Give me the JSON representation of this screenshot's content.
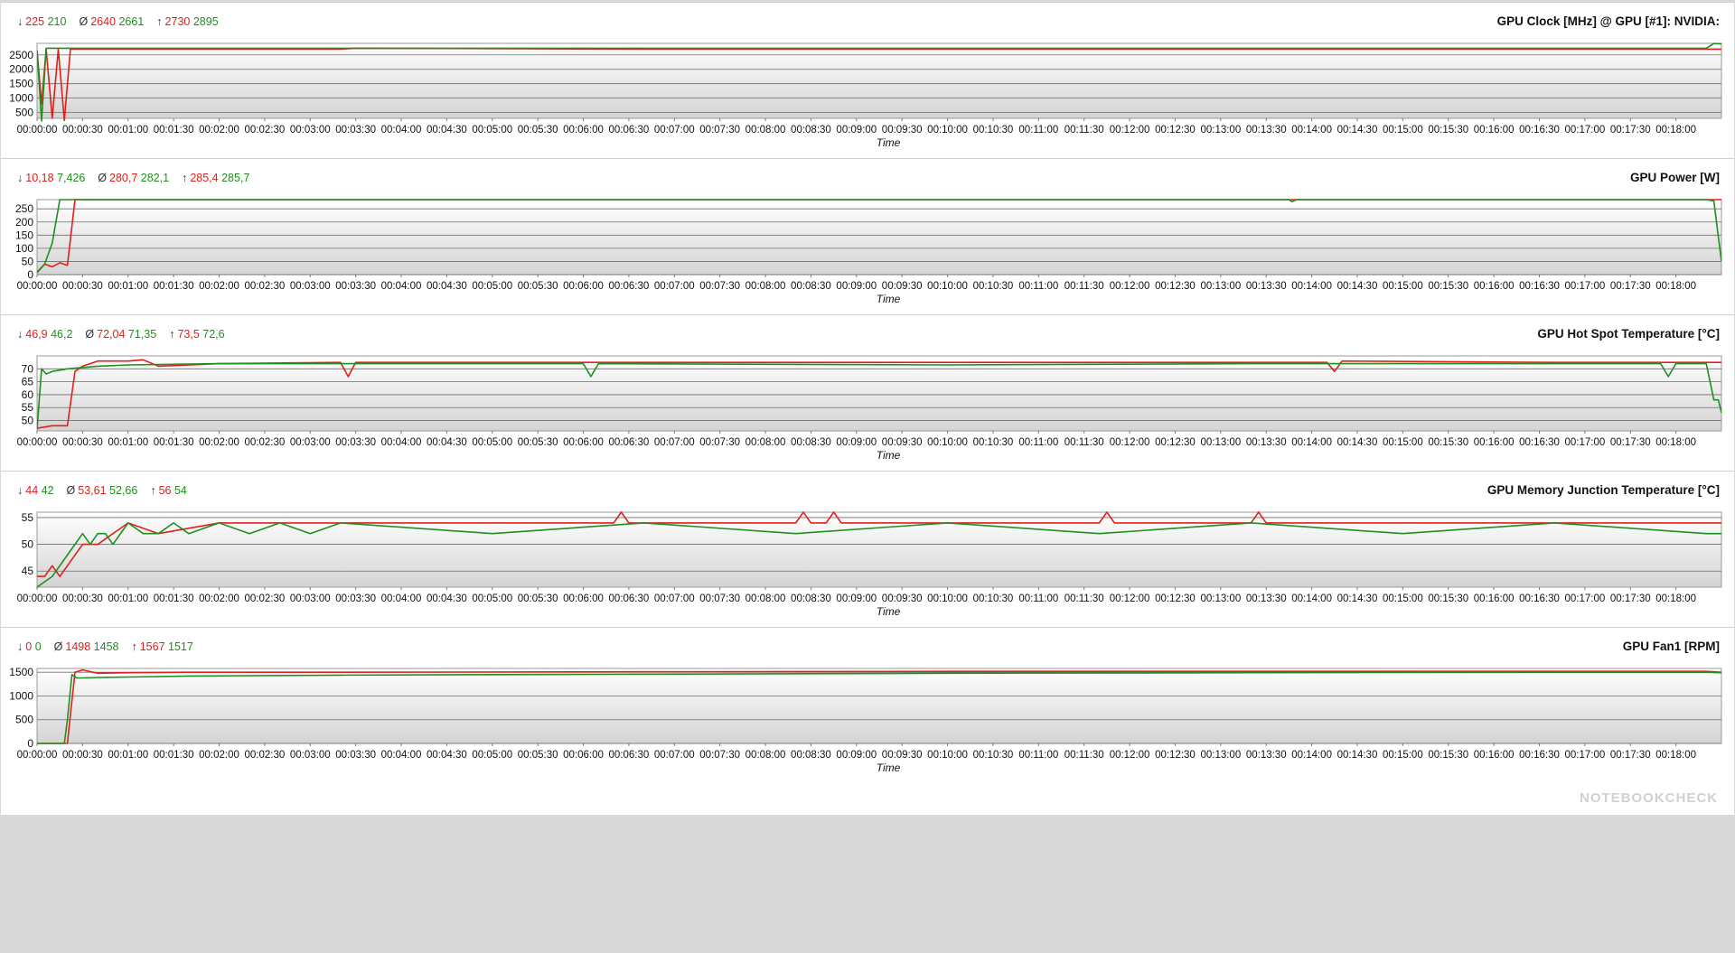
{
  "colors": {
    "run1": "#e0201c",
    "run2": "#1f8f1f"
  },
  "symbols": {
    "min": "↓",
    "avg": "Ø",
    "max": "↑"
  },
  "x_tick_labels": [
    "00:00:00",
    "00:00:30",
    "00:01:00",
    "00:01:30",
    "00:02:00",
    "00:02:30",
    "00:03:00",
    "00:03:30",
    "00:04:00",
    "00:04:30",
    "00:05:00",
    "00:05:30",
    "00:06:00",
    "00:06:30",
    "00:07:00",
    "00:07:30",
    "00:08:00",
    "00:08:30",
    "00:09:00",
    "00:09:30",
    "00:10:00",
    "00:10:30",
    "00:11:00",
    "00:11:30",
    "00:12:00",
    "00:12:30",
    "00:13:00",
    "00:13:30",
    "00:14:00",
    "00:14:30",
    "00:15:00",
    "00:15:30",
    "00:16:00",
    "00:16:30",
    "00:17:00",
    "00:17:30",
    "00:18:00"
  ],
  "watermark": "NOTEBOOKCHECK",
  "panels": [
    {
      "title": "GPU Clock [MHz] @ GPU [#1]: NVIDIA:",
      "stats": {
        "min": [
          "225",
          "210"
        ],
        "avg": [
          "2640",
          "2661"
        ],
        "max": [
          "2730",
          "2895"
        ]
      }
    },
    {
      "title": "GPU Power [W]",
      "stats": {
        "min": [
          "10,18",
          "7,426"
        ],
        "avg": [
          "280,7",
          "282,1"
        ],
        "max": [
          "285,4",
          "285,7"
        ]
      }
    },
    {
      "title": "GPU Hot Spot Temperature [°C]",
      "stats": {
        "min": [
          "46,9",
          "46,2"
        ],
        "avg": [
          "72,04",
          "71,35"
        ],
        "max": [
          "73,5",
          "72,6"
        ]
      }
    },
    {
      "title": "GPU Memory Junction Temperature [°C]",
      "stats": {
        "min": [
          "44",
          "42"
        ],
        "avg": [
          "53,61",
          "52,66"
        ],
        "max": [
          "56",
          "54"
        ]
      }
    },
    {
      "title": "GPU Fan1 [RPM]",
      "stats": {
        "min": [
          "0",
          "0"
        ],
        "avg": [
          "1498",
          "1458"
        ],
        "max": [
          "1567",
          "1517"
        ]
      }
    }
  ],
  "chart_data": [
    {
      "type": "line",
      "title": "GPU Clock [MHz] @ GPU [#1]: NVIDIA:",
      "xlabel": "Time",
      "ylabel": "",
      "ylim": [
        300,
        2900
      ],
      "yticks": [
        500,
        1000,
        1500,
        2000,
        2500
      ],
      "x_unit": "seconds",
      "xlim": [
        0,
        1110
      ],
      "series": [
        {
          "values_x": [
            0,
            3,
            6,
            10,
            14,
            18,
            22,
            30,
            60,
            200,
            210,
            400,
            600,
            800,
            1000,
            1100,
            1110
          ],
          "values": [
            2640,
            800,
            2700,
            300,
            2700,
            225,
            2700,
            2700,
            2700,
            2700,
            2730,
            2700,
            2700,
            2700,
            2700,
            2700,
            2700
          ]
        },
        {
          "values_x": [
            0,
            3,
            6,
            10,
            14,
            18,
            22,
            30,
            60,
            200,
            400,
            600,
            800,
            1000,
            1100,
            1105,
            1110
          ],
          "values": [
            2660,
            210,
            2730,
            2730,
            2730,
            2730,
            2730,
            2730,
            2730,
            2730,
            2730,
            2730,
            2730,
            2730,
            2730,
            2895,
            2880
          ]
        }
      ]
    },
    {
      "type": "line",
      "title": "GPU Power [W]",
      "xlabel": "Time",
      "ylabel": "",
      "ylim": [
        0,
        285
      ],
      "yticks": [
        0,
        50,
        100,
        150,
        200,
        250
      ],
      "x_unit": "seconds",
      "xlim": [
        0,
        1110
      ],
      "series": [
        {
          "values_x": [
            0,
            5,
            10,
            15,
            20,
            25,
            30,
            60,
            400,
            800,
            1100,
            1110
          ],
          "values": [
            10,
            40,
            30,
            45,
            35,
            285,
            285,
            285,
            285,
            285,
            285,
            285
          ]
        },
        {
          "values_x": [
            0,
            5,
            10,
            15,
            60,
            400,
            825,
            827,
            830,
            1100,
            1105,
            1110
          ],
          "values": [
            7,
            40,
            120,
            285,
            285,
            285,
            285,
            277,
            285,
            285,
            280,
            50
          ]
        }
      ]
    },
    {
      "type": "line",
      "title": "GPU Hot Spot Temperature [°C]",
      "xlabel": "Time",
      "ylabel": "",
      "ylim": [
        46,
        75
      ],
      "yticks": [
        50,
        55,
        60,
        65,
        70
      ],
      "x_unit": "seconds",
      "xlim": [
        0,
        1110
      ],
      "series": [
        {
          "values_x": [
            0,
            10,
            20,
            25,
            30,
            40,
            50,
            60,
            70,
            80,
            120,
            200,
            205,
            210,
            400,
            700,
            850,
            855,
            860,
            1000,
            1105,
            1110
          ],
          "values": [
            47,
            48,
            48,
            69,
            71,
            73,
            73,
            73,
            73.5,
            71,
            72,
            72.5,
            67,
            72.5,
            72.5,
            72.5,
            72.5,
            69,
            73,
            72.5,
            72.5,
            72.5
          ]
        },
        {
          "values_x": [
            0,
            3,
            6,
            10,
            20,
            40,
            60,
            120,
            360,
            365,
            370,
            600,
            800,
            1070,
            1075,
            1080,
            1100,
            1105,
            1108,
            1110
          ],
          "values": [
            46.5,
            70,
            68,
            69,
            70,
            71,
            71.5,
            72,
            72,
            67,
            72,
            71.5,
            72,
            72,
            67,
            72,
            72,
            58,
            58,
            53
          ]
        }
      ]
    },
    {
      "type": "line",
      "title": "GPU Memory Junction Temperature [°C]",
      "xlabel": "Time",
      "ylabel": "",
      "ylim": [
        42,
        56
      ],
      "yticks": [
        45,
        50,
        55
      ],
      "x_unit": "seconds",
      "xlim": [
        0,
        1110
      ],
      "series": [
        {
          "values_x": [
            0,
            5,
            10,
            15,
            20,
            25,
            30,
            40,
            50,
            60,
            80,
            120,
            200,
            380,
            385,
            390,
            500,
            505,
            510,
            520,
            525,
            530,
            700,
            705,
            710,
            800,
            805,
            810,
            900,
            1100,
            1110
          ],
          "values": [
            44,
            44,
            46,
            44,
            46,
            48,
            50,
            50,
            52,
            54,
            52,
            54,
            54,
            54,
            56,
            54,
            54,
            56,
            54,
            54,
            56,
            54,
            54,
            56,
            54,
            54,
            56,
            54,
            54,
            54,
            54
          ]
        },
        {
          "values_x": [
            0,
            10,
            20,
            25,
            30,
            35,
            40,
            45,
            50,
            60,
            70,
            80,
            90,
            100,
            120,
            140,
            160,
            180,
            200,
            300,
            400,
            500,
            600,
            700,
            800,
            900,
            1000,
            1100,
            1110
          ],
          "values": [
            42,
            44,
            48,
            50,
            52,
            50,
            52,
            52,
            50,
            54,
            52,
            52,
            54,
            52,
            54,
            52,
            54,
            52,
            54,
            52,
            54,
            52,
            54,
            52,
            54,
            52,
            54,
            52,
            52
          ]
        }
      ]
    },
    {
      "type": "line",
      "title": "GPU Fan1 [RPM]",
      "xlabel": "Time",
      "ylabel": "",
      "ylim": [
        0,
        1580
      ],
      "yticks": [
        0,
        500,
        1000,
        1500
      ],
      "x_unit": "seconds",
      "xlim": [
        0,
        1110
      ],
      "series": [
        {
          "values_x": [
            0,
            20,
            22,
            25,
            30,
            40,
            60,
            100,
            200,
            400,
            600,
            800,
            1000,
            1100,
            1110
          ],
          "values": [
            0,
            0,
            600,
            1500,
            1550,
            1480,
            1490,
            1500,
            1500,
            1510,
            1520,
            1520,
            1520,
            1520,
            1500
          ]
        },
        {
          "values_x": [
            0,
            18,
            20,
            23,
            26,
            30,
            40,
            60,
            100,
            200,
            400,
            600,
            800,
            1000,
            1100,
            1110
          ],
          "values": [
            0,
            0,
            500,
            1450,
            1380,
            1380,
            1390,
            1400,
            1420,
            1440,
            1460,
            1480,
            1490,
            1500,
            1500,
            1490
          ]
        }
      ]
    }
  ]
}
